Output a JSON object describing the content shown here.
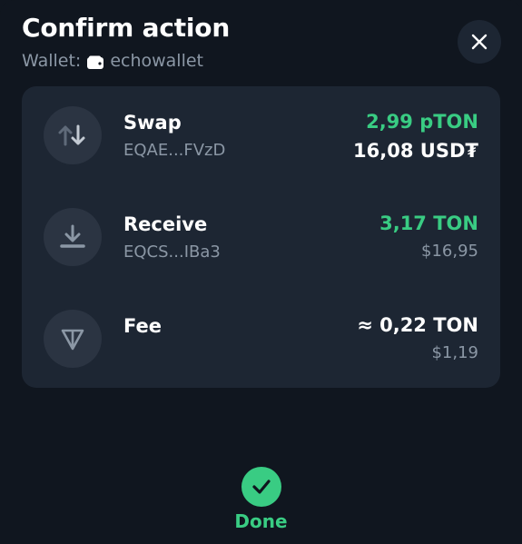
{
  "header": {
    "title": "Confirm action",
    "wallet_label": "Wallet:",
    "wallet_name": "echowallet"
  },
  "actions": [
    {
      "label": "Swap",
      "address": "EQAE...FVzD",
      "amount": "2,99 pTON",
      "sub_amount": "16,08 USD₮",
      "icon": "swap-arrows-icon"
    },
    {
      "label": "Receive",
      "address": "EQCS...IBa3",
      "amount": "3,17 TON",
      "sub_amount": "$16,95",
      "icon": "receive-arrow-icon"
    },
    {
      "label": "Fee",
      "address": "",
      "amount": "≈ 0,22 TON",
      "sub_amount": "$1,19",
      "icon": "ton-logo-icon"
    }
  ],
  "footer": {
    "done_label": "Done"
  },
  "colors": {
    "background": "#10161f",
    "card": "#1d2633",
    "accent_green": "#39cc83",
    "secondary_text": "#8b97a5"
  }
}
